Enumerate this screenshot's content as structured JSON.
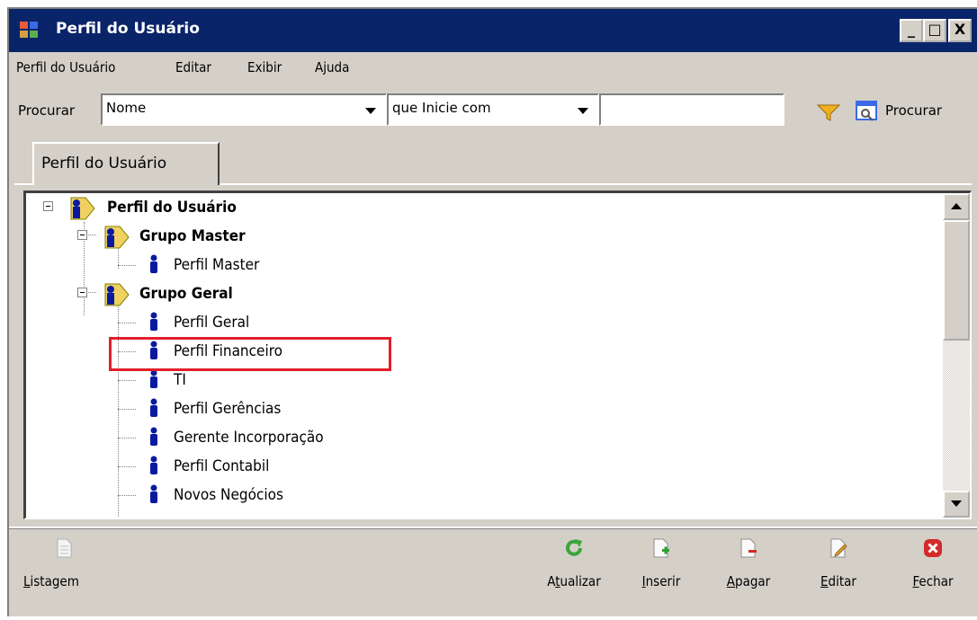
{
  "window": {
    "title": "Perfil do Usuário",
    "controls": [
      "_",
      "□",
      "X"
    ]
  },
  "menu": [
    "Perfil do Usuário",
    "Editar",
    "Exibir",
    "Ajuda"
  ],
  "search": {
    "label": "Procurar",
    "field_value": "Nome",
    "condition_value": "que Inicie com",
    "text_value": "",
    "button_label": "Procurar"
  },
  "tab": {
    "label": "Perfil do Usuário"
  },
  "tree": {
    "root": "Perfil do Usuário",
    "groups": [
      {
        "label": "Grupo Master",
        "items": [
          "Perfil Master"
        ]
      },
      {
        "label": "Grupo Geral",
        "items": [
          "Perfil Geral",
          "Perfil Financeiro",
          "TI",
          "Perfil Gerências",
          "Gerente Incorporação",
          "Perfil Contabil",
          "Novos Negócios"
        ]
      }
    ],
    "highlighted_item": "Perfil Financeiro",
    "highlight_color": "#e0202a"
  },
  "toolbar": {
    "listagem": {
      "first": "L",
      "rest": "istagem"
    },
    "atualizar": {
      "pre": "A",
      "u": "t",
      "post": "ualizar"
    },
    "inserir": {
      "first": "I",
      "rest": "nserir"
    },
    "apagar": {
      "first": "A",
      "rest": "pagar"
    },
    "editar": {
      "first": "E",
      "rest": "ditar"
    },
    "fechar": {
      "first": "F",
      "rest": "echar"
    }
  },
  "colors": {
    "titlebar": "#0a246a",
    "window": "#d4d0c8",
    "refresh": "#3aa53a",
    "close": "#d42a2a",
    "person": "#0a1aa0"
  }
}
